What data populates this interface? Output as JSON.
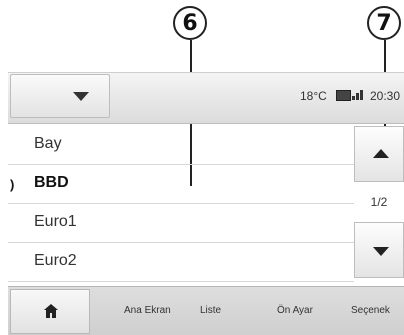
{
  "callouts": {
    "left": "6",
    "right": "7"
  },
  "status": {
    "temperature": "18°C",
    "time": "20:30"
  },
  "stations": [
    {
      "label": "Bay",
      "playing": false
    },
    {
      "label": "BBD",
      "playing": true
    },
    {
      "label": "Euro1",
      "playing": false
    },
    {
      "label": "Euro2",
      "playing": false
    }
  ],
  "playing_icon": ")",
  "pagination": "1/2",
  "nav": {
    "home": "Ana Ekran",
    "list": "Liste",
    "presets": "Ön Ayar",
    "options": "Seçenek"
  },
  "icons": [
    "chevron-down-icon",
    "battery-icon",
    "signal-icon",
    "radio-playing-icon",
    "arrow-up-icon",
    "arrow-down-icon",
    "home-icon"
  ]
}
